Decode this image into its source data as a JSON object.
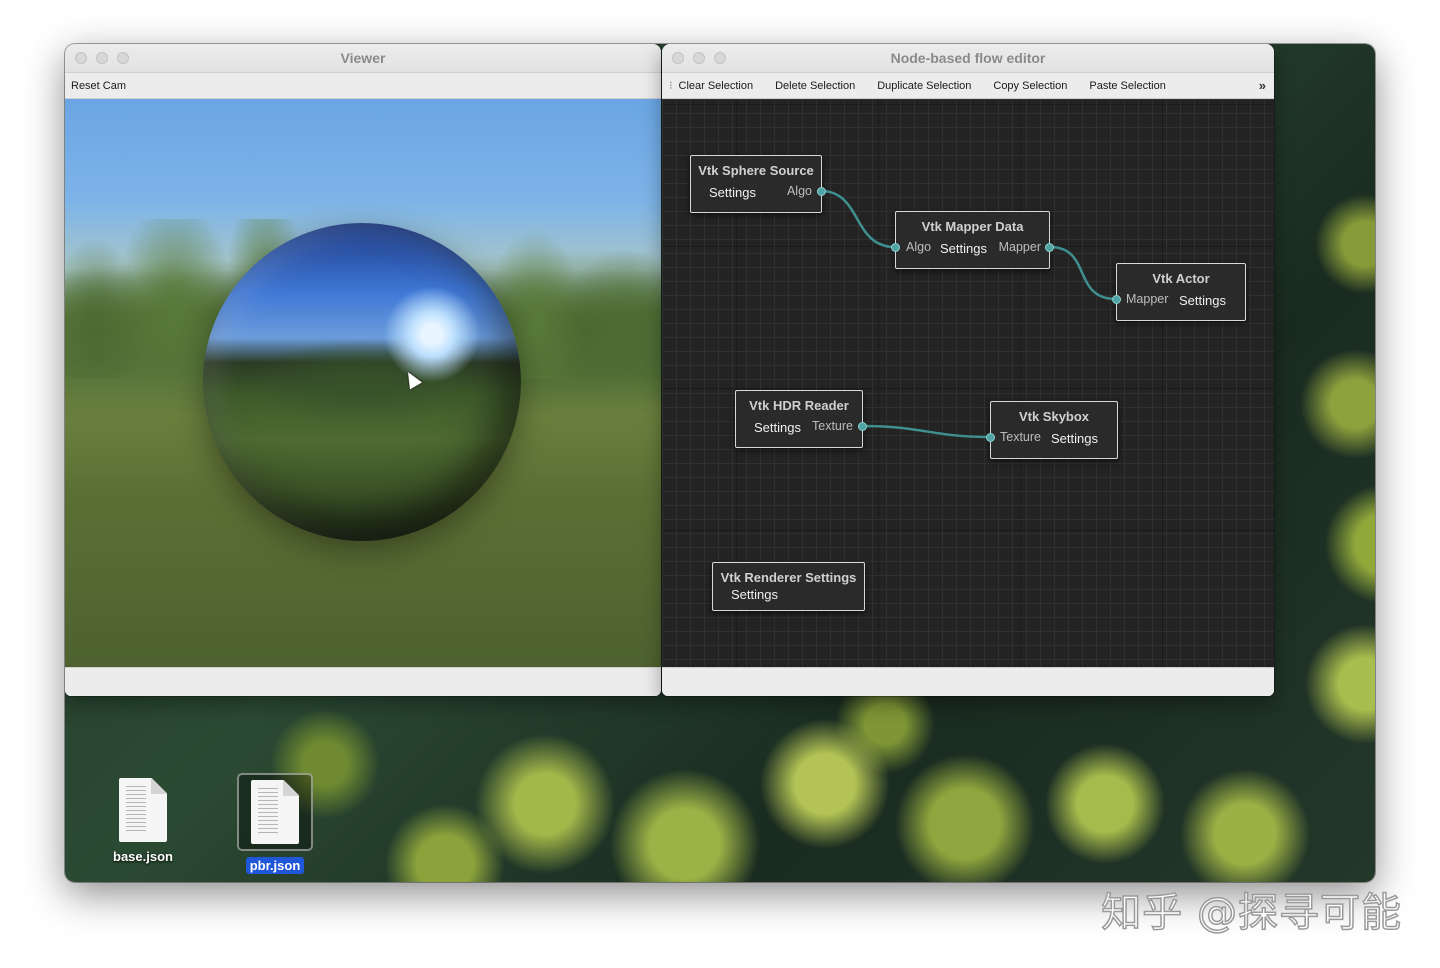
{
  "viewer": {
    "title": "Viewer",
    "toolbar": {
      "reset_cam": "Reset Cam"
    }
  },
  "editor": {
    "title": "Node-based flow editor",
    "toolbar": {
      "clear": "Clear Selection",
      "delete": "Delete Selection",
      "duplicate": "Duplicate Selection",
      "copy": "Copy Selection",
      "paste": "Paste Selection",
      "more": "»"
    },
    "nodes": [
      {
        "title": "Vtk Sphere Source",
        "left": "Settings",
        "right": "Algo"
      },
      {
        "title": "Vtk Mapper Data",
        "in": "Algo",
        "mid": "Settings",
        "out": "Mapper"
      },
      {
        "title": "Vtk Actor",
        "in": "Mapper",
        "mid": "Settings"
      },
      {
        "title": "Vtk HDR Reader",
        "left": "Settings",
        "right": "Texture"
      },
      {
        "title": "Vtk Skybox",
        "in": "Texture",
        "mid": "Settings"
      },
      {
        "title": "Vtk Renderer Settings",
        "left": "Settings"
      }
    ],
    "link_color": "#3f8f8f"
  },
  "desktop": {
    "files": [
      {
        "name": "base.json",
        "selected": false
      },
      {
        "name": "pbr.json",
        "selected": true
      }
    ],
    "watermark": "知乎 @探寻可能"
  }
}
